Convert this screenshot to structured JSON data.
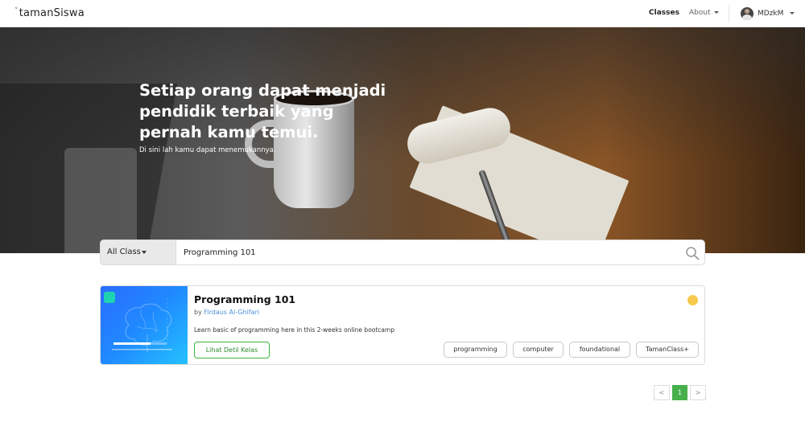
{
  "navbar": {
    "logo": "tamanSiswa",
    "logo_mark": "˅",
    "classes_label": "Classes",
    "about_label": "About",
    "username": "MDzkM"
  },
  "hero": {
    "title": "Setiap orang dapat menjadi pendidik terbaik yang pernah kamu temui.",
    "subtitle": "Di sini lah kamu dapat menemukannya."
  },
  "search": {
    "category_label": "All Class",
    "query": "Programming 101"
  },
  "class_card": {
    "title": "Programming 101",
    "by_label": "by",
    "author": "Firdaus Al-Ghifari",
    "description": "Learn basic of programming here in this 2-weeks online bootcamp",
    "detail_button": "Lihat Detil Kelas",
    "status_color": "#f5c94c",
    "tags": [
      "programming",
      "computer",
      "foundational",
      "TamanClass+"
    ]
  },
  "pagination": {
    "prev": "<",
    "current": "1",
    "next": ">"
  },
  "colors": {
    "accent_green": "#47b04b",
    "link_blue": "#4a90d9"
  }
}
